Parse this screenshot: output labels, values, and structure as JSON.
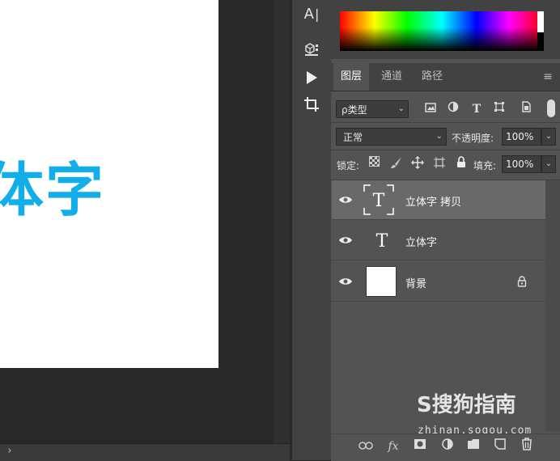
{
  "canvas": {
    "text": "体字",
    "text_color": "#12aeea"
  },
  "tools": [
    {
      "name": "type-tool",
      "glyph": "A|"
    },
    {
      "name": "3d-material-tool",
      "glyph": "⧉"
    },
    {
      "name": "play-button",
      "glyph": "▶"
    },
    {
      "name": "crop-tool",
      "glyph": "⌗"
    }
  ],
  "panel_tabs": [
    {
      "label": "图层",
      "active": true
    },
    {
      "label": "通道",
      "active": false
    },
    {
      "label": "路径",
      "active": false
    }
  ],
  "filter": {
    "label": "ρ类型",
    "icons": [
      "image-filter-icon",
      "adjustment-filter-icon",
      "type-filter-icon",
      "shape-filter-icon",
      "smart-object-filter-icon"
    ]
  },
  "blend": {
    "mode": "正常",
    "opacity_label": "不透明度:",
    "opacity_value": "100%"
  },
  "lock": {
    "label": "锁定:",
    "fill_label": "填充:",
    "fill_value": "100%"
  },
  "layers": [
    {
      "name": "立体字 拷贝",
      "type": "text",
      "selected": true,
      "locked": false
    },
    {
      "name": "立体字",
      "type": "text",
      "selected": false,
      "locked": false
    },
    {
      "name": "背景",
      "type": "background",
      "selected": false,
      "locked": true
    }
  ],
  "watermark": {
    "text": "S搜狗指南",
    "url": "zhinan.sogou.com"
  },
  "bottom_icons": [
    "link-layers-icon",
    "fx-icon",
    "add-mask-icon",
    "adjustment-layer-icon",
    "new-group-icon",
    "new-layer-icon",
    "delete-layer-icon"
  ]
}
